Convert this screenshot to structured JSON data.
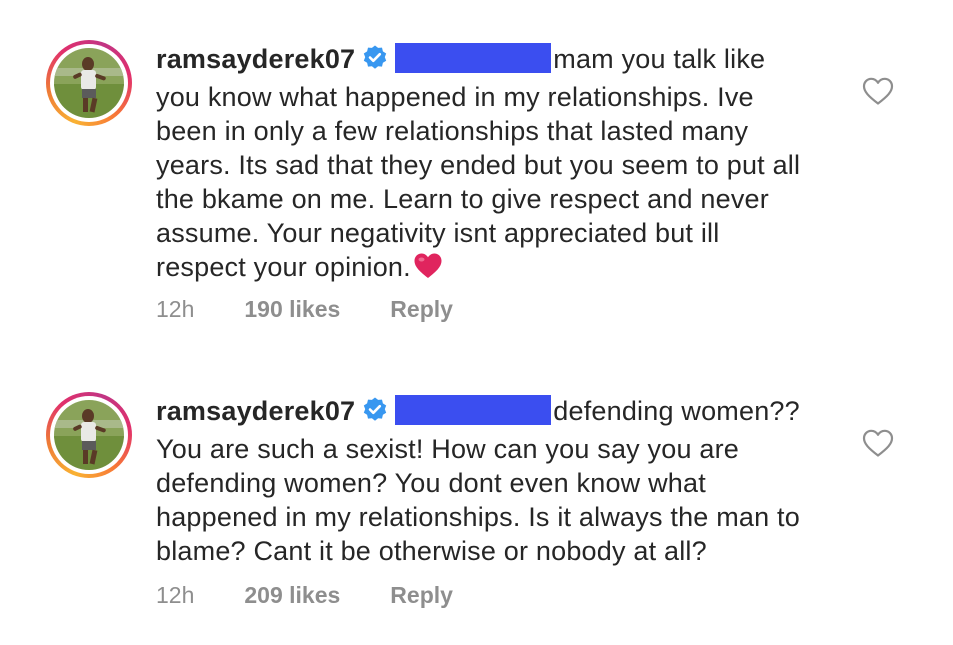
{
  "comments": [
    {
      "username": "ramsayderek07",
      "text": "mam you talk like you know what happened in my relationships. Ive been in only a few relationships that lasted many years. Its sad that they ended but you seem to put all the bkame on me. Learn to give respect and never assume. Your negativity isnt appreciated but ill respect your opinion.",
      "emoji": "red-heart",
      "time": "12h",
      "likes": "190 likes",
      "reply": "Reply"
    },
    {
      "username": "ramsayderek07",
      "text": "defending women?? You are such a sexist! How can you say you are defending women? You dont even know what happened in my relationships. Is it always the man to blame? Cant it be otherwise or nobody at all?",
      "time": "12h",
      "likes": "209 likes",
      "reply": "Reply"
    }
  ],
  "icons": {
    "verified": "verified-badge-icon",
    "like": "heart-outline-icon"
  },
  "colors": {
    "verified": "#3897f0",
    "redaction": "#3b4ef0",
    "meta_text": "#8e8e8e",
    "emoji_heart": "#e0245e"
  }
}
